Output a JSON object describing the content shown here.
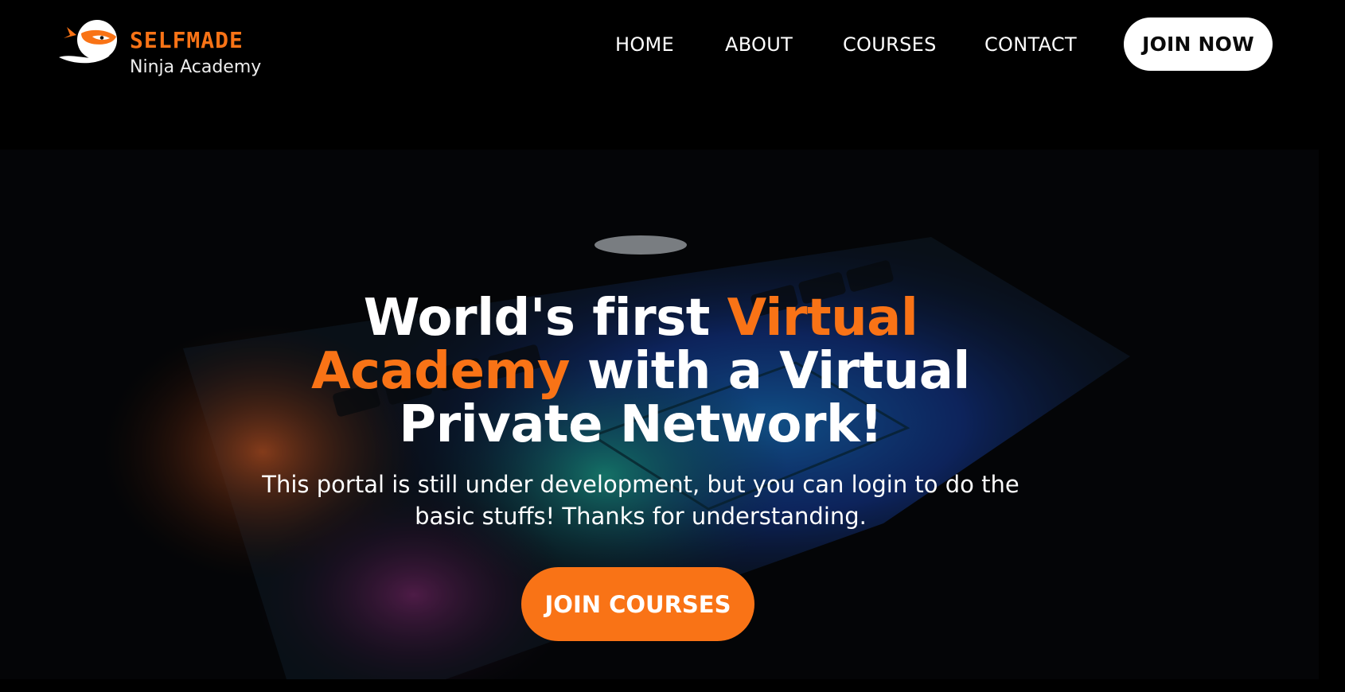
{
  "brand": {
    "name_top": "SELFMADE",
    "name_bottom": "Ninja Academy",
    "logo_icon": "ninja-mascot-icon"
  },
  "nav": {
    "items": [
      {
        "label": "HOME"
      },
      {
        "label": "ABOUT"
      },
      {
        "label": "COURSES"
      },
      {
        "label": "CONTACT"
      }
    ],
    "cta_label": "JOIN NOW"
  },
  "hero": {
    "title_part1": "World's first ",
    "title_accent1": "Virtual Academy",
    "title_part2": " with a Virtual Private Network!",
    "subtitle": "This portal is still under development, but you can login to do the basic stuffs! Thanks for understanding.",
    "cta_label": "JOIN COURSES",
    "background_image": "laptop-keyboard-photo"
  },
  "colors": {
    "accent": "#f97316",
    "background": "#000000",
    "text": "#ffffff",
    "button_light": "#ffffff"
  }
}
